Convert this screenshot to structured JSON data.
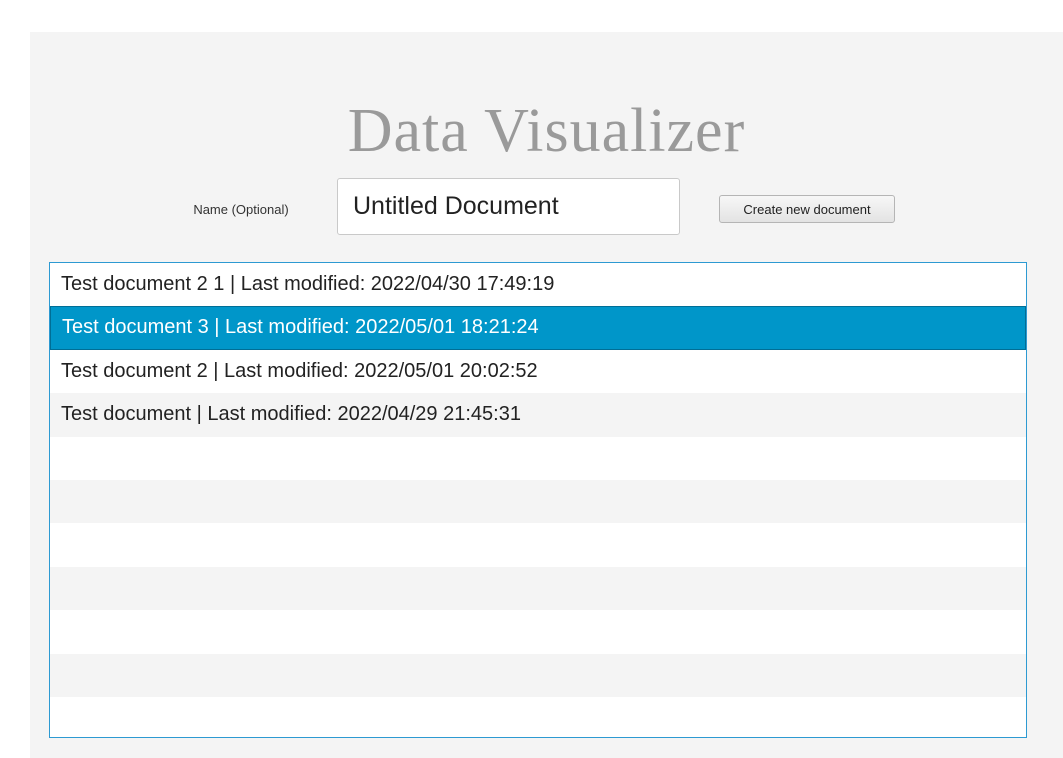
{
  "app": {
    "title": "Data Visualizer"
  },
  "form": {
    "name_label": "Name (Optional)",
    "name_value": "Untitled Document",
    "create_button_label": "Create new document"
  },
  "documents": {
    "selected_index": 1,
    "items": [
      "Test document 2 1 | Last modified: 2022/04/30 17:49:19",
      "Test document 3 | Last modified: 2022/05/01 18:21:24",
      "Test document 2 | Last modified: 2022/05/01 20:02:52",
      "Test document | Last modified: 2022/04/29 21:45:31",
      "",
      "",
      "",
      "",
      "",
      "",
      ""
    ]
  },
  "colors": {
    "title_text": "#9a9a9a",
    "selection": "#0096c9",
    "list_border": "#2d9ad2",
    "window_background": "#f4f4f4"
  }
}
